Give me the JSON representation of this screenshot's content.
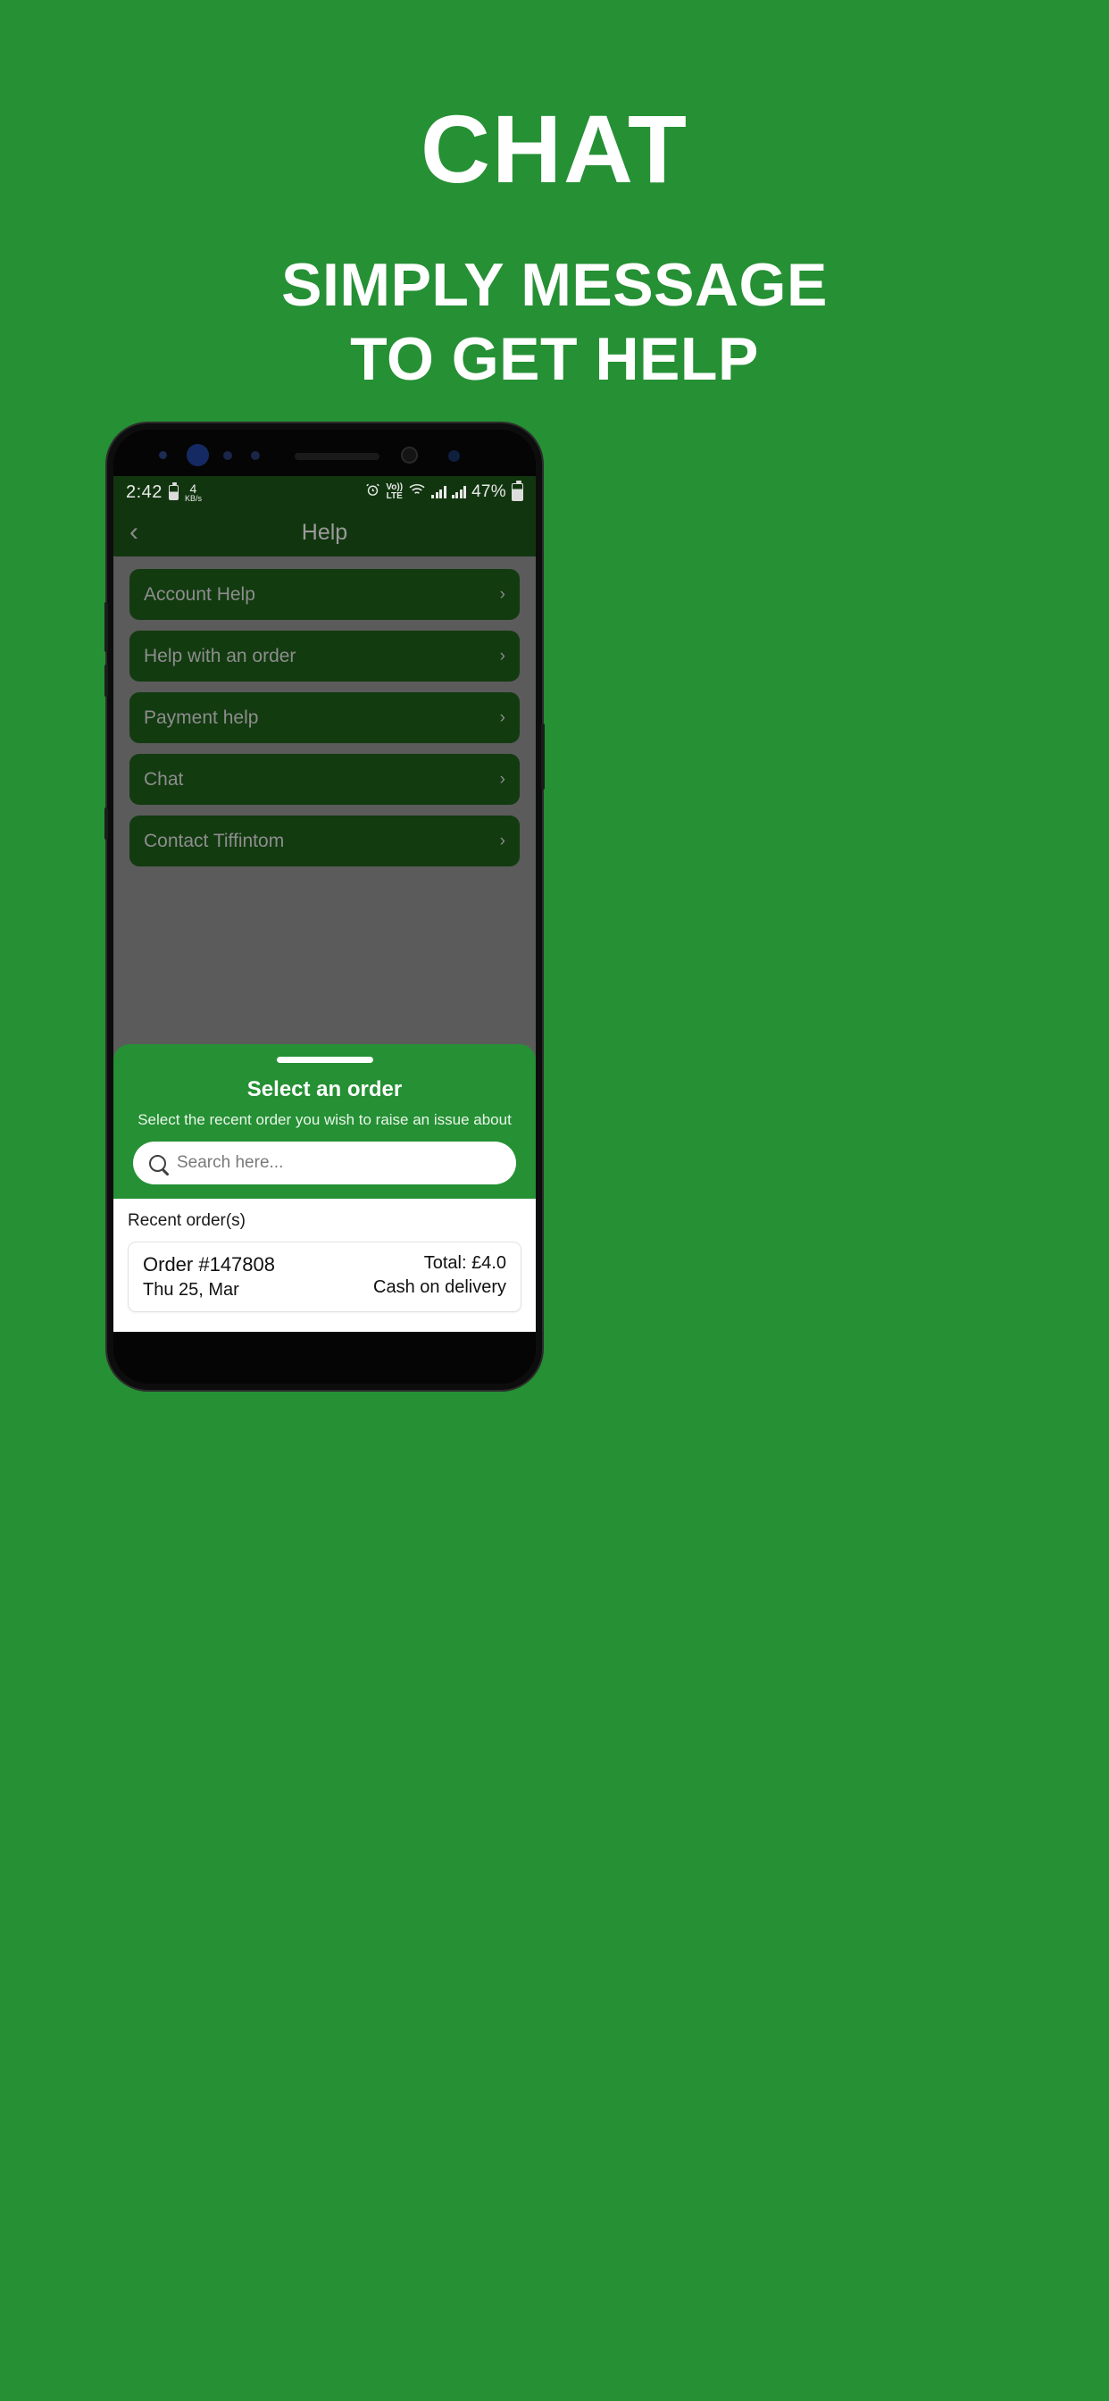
{
  "promo": {
    "title": "CHAT",
    "subtitle_line1": "SIMPLY MESSAGE",
    "subtitle_line2": "TO GET HELP",
    "background_color": "#259034",
    "text_color": "#ffffff"
  },
  "phone": {
    "status_bar": {
      "time": "2:42",
      "battery_small_icon": "battery-icon",
      "network_speed_value": "4",
      "network_speed_unit": "KB/s",
      "alarm_icon": "alarm-clock-icon",
      "volte_top": "Vo))",
      "volte_bottom": "LTE",
      "wifi_icon": "wifi-icon",
      "signal_icon_1": "signal-bars-icon",
      "signal_icon_2": "signal-bars-icon",
      "battery_percent": "47%",
      "battery_icon": "battery-icon"
    },
    "app_header": {
      "back_icon": "chevron-left-icon",
      "title": "Help"
    },
    "menu": {
      "items": [
        {
          "label": "Account Help",
          "chevron": "›"
        },
        {
          "label": "Help with an order",
          "chevron": "›"
        },
        {
          "label": "Payment help",
          "chevron": "›"
        },
        {
          "label": "Chat",
          "chevron": "›"
        },
        {
          "label": "Contact Tiffintom",
          "chevron": "›"
        }
      ]
    },
    "sheet": {
      "title": "Select an order",
      "subtitle": "Select the recent order you wish to raise an issue about",
      "search_placeholder": "Search here...",
      "orders_heading": "Recent order(s)",
      "orders": [
        {
          "order_id": "Order #147808",
          "date": "Thu 25, Mar",
          "total": "Total: £4.0",
          "payment": "Cash on delivery"
        }
      ]
    }
  }
}
